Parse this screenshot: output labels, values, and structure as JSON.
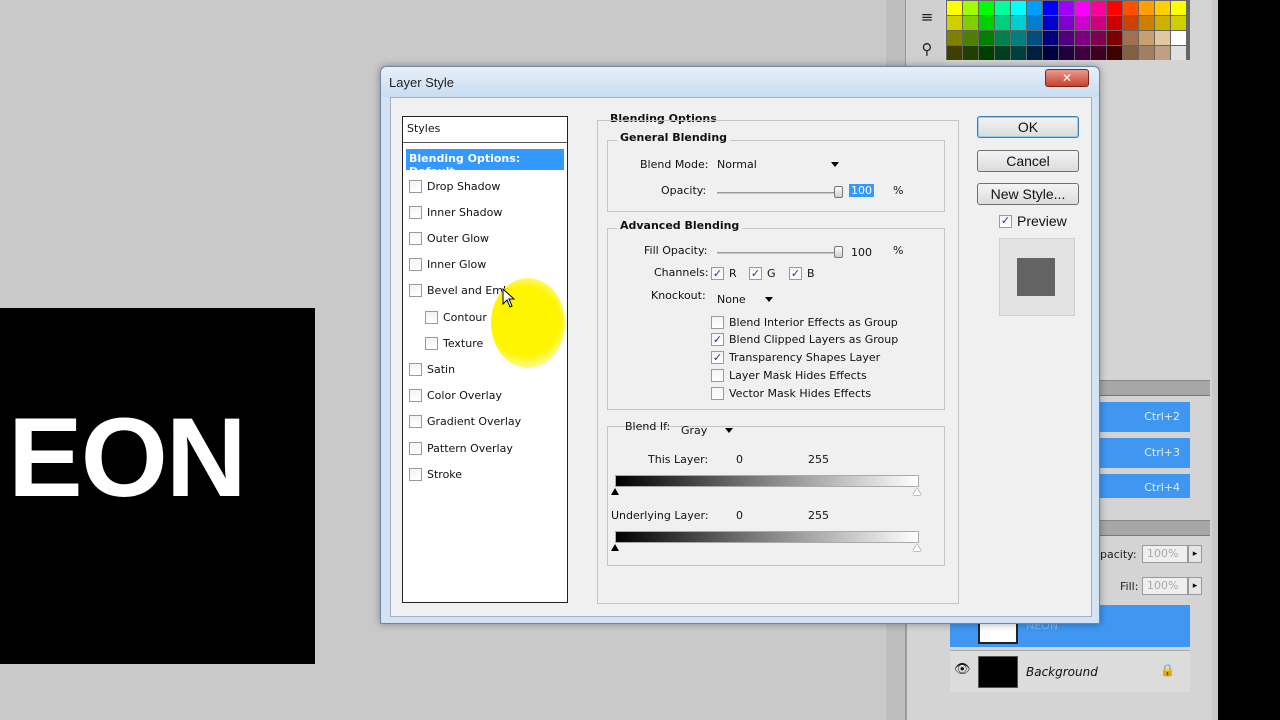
{
  "canvas": {
    "text": "EON"
  },
  "panels": {
    "layers_shortcuts": [
      "Ctrl+2",
      "Ctrl+3",
      "Ctrl+4"
    ],
    "opacity_label": "pacity:",
    "opacity_value": "100%",
    "fill_label": "Fill:",
    "fill_value": "100%",
    "layer_neon_name": "NEON",
    "layer_background_name": "Background"
  },
  "dialog": {
    "title": "Layer Style",
    "close_glyph": "✕",
    "styles_header": "Styles",
    "selected_style": "Blending Options: Default",
    "styles": [
      {
        "label": "Drop Shadow",
        "checked": false
      },
      {
        "label": "Inner Shadow",
        "checked": false
      },
      {
        "label": "Outer Glow",
        "checked": false
      },
      {
        "label": "Inner Glow",
        "checked": false
      },
      {
        "label": "Bevel and Emboss",
        "checked": false
      },
      {
        "label": "Contour",
        "checked": false
      },
      {
        "label": "Texture",
        "checked": false
      },
      {
        "label": "Satin",
        "checked": false
      },
      {
        "label": "Color Overlay",
        "checked": false
      },
      {
        "label": "Gradient Overlay",
        "checked": false
      },
      {
        "label": "Pattern Overlay",
        "checked": false
      },
      {
        "label": "Stroke",
        "checked": false
      }
    ],
    "blending_options_title": "Blending Options",
    "general_blending_title": "General Blending",
    "blend_mode_label": "Blend Mode:",
    "blend_mode_value": "Normal",
    "opacity_label": "Opacity:",
    "opacity_value": "100",
    "opacity_percent": 100,
    "percent_sign": "%",
    "advanced_blending_title": "Advanced Blending",
    "fill_opacity_label": "Fill Opacity:",
    "fill_opacity_value": "100",
    "fill_opacity_percent": 100,
    "channels_label": "Channels:",
    "channels": [
      {
        "label": "R",
        "checked": true
      },
      {
        "label": "G",
        "checked": true
      },
      {
        "label": "B",
        "checked": true
      }
    ],
    "knockout_label": "Knockout:",
    "knockout_value": "None",
    "advanced_options": [
      {
        "label": "Blend Interior Effects as Group",
        "checked": false
      },
      {
        "label": "Blend Clipped Layers as Group",
        "checked": true
      },
      {
        "label": "Transparency Shapes Layer",
        "checked": true
      },
      {
        "label": "Layer Mask Hides Effects",
        "checked": false
      },
      {
        "label": "Vector Mask Hides Effects",
        "checked": false
      }
    ],
    "blend_if_label": "Blend If:",
    "blend_if_value": "Gray",
    "this_layer_label": "This Layer:",
    "this_layer_min": "0",
    "this_layer_max": "255",
    "underlying_layer_label": "Underlying Layer:",
    "underlying_layer_min": "0",
    "underlying_layer_max": "255",
    "ok_label": "OK",
    "cancel_label": "Cancel",
    "new_style_label": "New Style...",
    "preview_label": "Preview",
    "preview_checked": true,
    "check_glyph": "✓"
  },
  "colors": {
    "selection": "#3399ff",
    "cursor_highlight": "#fff500",
    "preview_swatch": "#636363"
  }
}
